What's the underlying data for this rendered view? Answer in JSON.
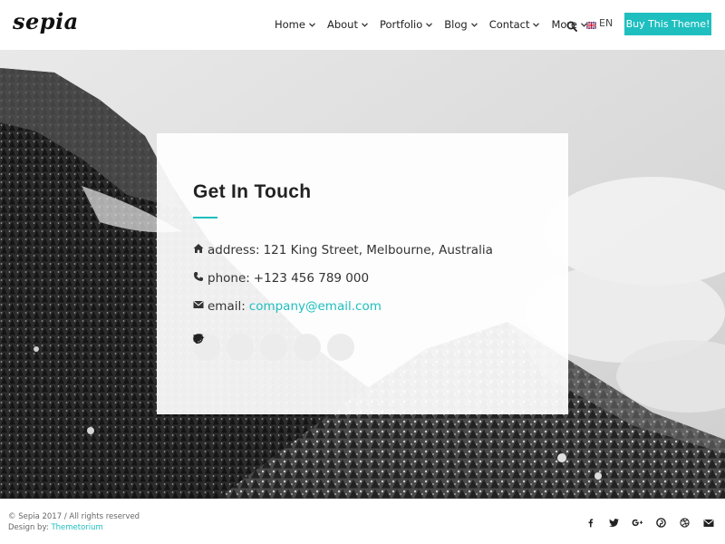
{
  "brand": {
    "logo_text": "sepia"
  },
  "nav": {
    "items": [
      {
        "label": "Home"
      },
      {
        "label": "About"
      },
      {
        "label": "Portfolio"
      },
      {
        "label": "Blog"
      },
      {
        "label": "Contact"
      },
      {
        "label": "More"
      }
    ],
    "language": "EN",
    "search_icon": "search-icon",
    "flag_icon": "uk-flag-icon",
    "cta_label": "Buy This Theme!"
  },
  "contact_card": {
    "title": "Get In Touch",
    "address_label": "address:",
    "address_value": "121 King Street, Melbourne, Australia",
    "phone_label": "phone:",
    "phone_value": "+123 456 789 000",
    "email_label": "email:",
    "email_value": "company@email.com",
    "socials": [
      "facebook-icon",
      "twitter-icon",
      "google-plus-icon",
      "pinterest-icon",
      "dribbble-icon"
    ]
  },
  "footer": {
    "copyright": "© Sepia 2017  /  All rights reserved",
    "design_prefix": "Design by:",
    "design_credit": "Themetorium",
    "socials": [
      "facebook-icon",
      "twitter-icon",
      "google-plus-icon",
      "pinterest-icon",
      "dribbble-icon",
      "envelope-icon"
    ]
  },
  "colors": {
    "accent": "#1fbfbf",
    "text": "#222222",
    "background": "#ffffff"
  }
}
